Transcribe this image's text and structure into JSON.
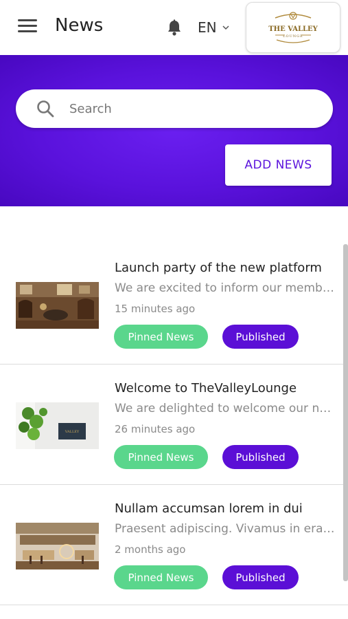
{
  "header": {
    "title": "News",
    "language": "EN",
    "logo_text": "THE VALLEY",
    "logo_subtext": "LOUNGE"
  },
  "search": {
    "placeholder": "Search"
  },
  "actions": {
    "add_label": "ADD NEWS"
  },
  "colors": {
    "accent": "#5b0fd6",
    "banner": "#5a12dc",
    "pinned": "#5ad68c",
    "published": "#5b0fd6"
  },
  "news": [
    {
      "title": "Launch party of the new platform",
      "description": "We are excited to inform our members about the launch",
      "time": "15 minutes ago",
      "pinned_label": "Pinned News",
      "status_label": "Published"
    },
    {
      "title": "Welcome to TheValleyLounge",
      "description": "We are delighted to welcome our new members",
      "time": "26 minutes ago",
      "pinned_label": "Pinned News",
      "status_label": "Published"
    },
    {
      "title": "Nullam accumsan lorem in dui",
      "description": "Praesent adipiscing. Vivamus in erat ut urna cursus",
      "time": "2 months ago",
      "pinned_label": "Pinned News",
      "status_label": "Published"
    }
  ]
}
